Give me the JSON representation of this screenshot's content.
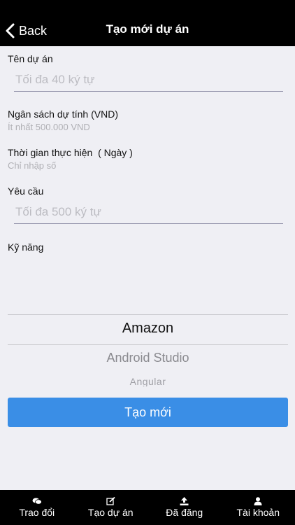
{
  "nav": {
    "back_label": "Back",
    "title": "Tạo mới dự án"
  },
  "form": {
    "project_name": {
      "label": "Tên dự án",
      "placeholder": "Tối đa 40 ký tự",
      "value": ""
    },
    "budget": {
      "label": "Ngân sách dự tính (VND)",
      "hint": "Ít nhất 500.000 VND"
    },
    "duration": {
      "label": "Thời gian thực hiện  ( Ngày )",
      "hint": "Chỉ nhập số"
    },
    "requirements": {
      "label": "Yêu cầu",
      "placeholder": "Tối đa 500 ký tự",
      "value": ""
    },
    "skills": {
      "label": "Kỹ năng",
      "options": [
        "Amazon",
        "Android Studio",
        "Angular"
      ],
      "selected": "Amazon"
    },
    "submit_label": "Tạo mới"
  },
  "tabbar": {
    "tabs": [
      {
        "label": "Trao đổi",
        "icon": "chat-icon"
      },
      {
        "label": "Tạo dự án",
        "icon": "edit-icon"
      },
      {
        "label": "Đã đăng",
        "icon": "upload-icon"
      },
      {
        "label": "Tài khoản",
        "icon": "user-icon"
      }
    ]
  },
  "colors": {
    "bar_background": "#000000",
    "page_background": "#efeff4",
    "primary_button": "#3a8ee6"
  }
}
